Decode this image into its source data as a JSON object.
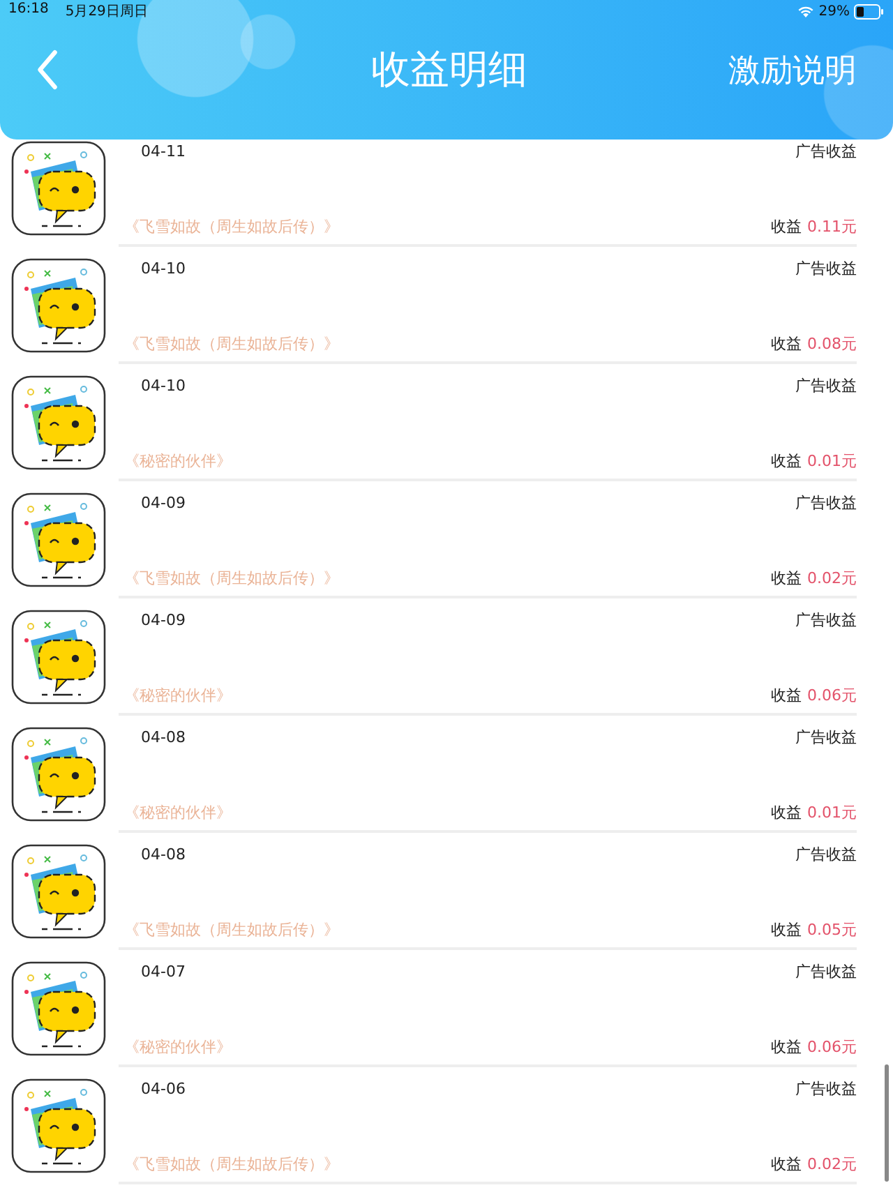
{
  "status_bar": {
    "time": "16:18",
    "date": "5月29日周日",
    "battery": "29%"
  },
  "header": {
    "title": "收益明细",
    "action": "激励说明"
  },
  "records": [
    {
      "date": "04-11",
      "type": "广告收益",
      "book": "《飞雪如故（周生如故后传）》",
      "label": "收益",
      "amount": "0.11元"
    },
    {
      "date": "04-10",
      "type": "广告收益",
      "book": "《飞雪如故（周生如故后传）》",
      "label": "收益",
      "amount": "0.08元"
    },
    {
      "date": "04-10",
      "type": "广告收益",
      "book": "《秘密的伙伴》",
      "label": "收益",
      "amount": "0.01元"
    },
    {
      "date": "04-09",
      "type": "广告收益",
      "book": "《飞雪如故（周生如故后传）》",
      "label": "收益",
      "amount": "0.02元"
    },
    {
      "date": "04-09",
      "type": "广告收益",
      "book": "《秘密的伙伴》",
      "label": "收益",
      "amount": "0.06元"
    },
    {
      "date": "04-08",
      "type": "广告收益",
      "book": "《秘密的伙伴》",
      "label": "收益",
      "amount": "0.01元"
    },
    {
      "date": "04-08",
      "type": "广告收益",
      "book": "《飞雪如故（周生如故后传）》",
      "label": "收益",
      "amount": "0.05元"
    },
    {
      "date": "04-07",
      "type": "广告收益",
      "book": "《秘密的伙伴》",
      "label": "收益",
      "amount": "0.06元"
    },
    {
      "date": "04-06",
      "type": "广告收益",
      "book": "《飞雪如故（周生如故后传）》",
      "label": "收益",
      "amount": "0.02元"
    }
  ]
}
